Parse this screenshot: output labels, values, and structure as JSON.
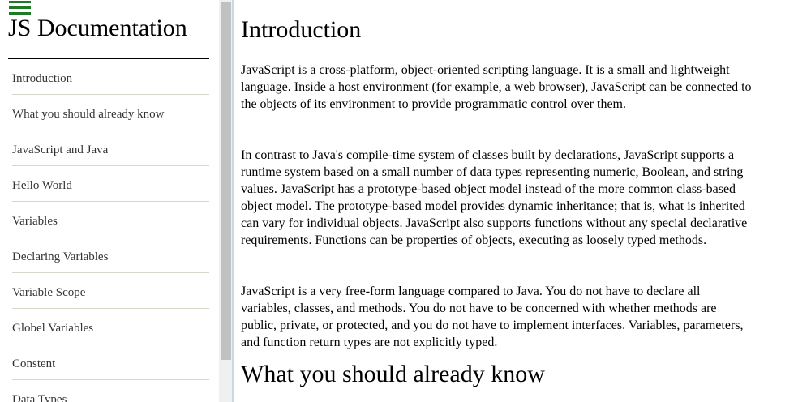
{
  "sidebar": {
    "menu_icon": "hamburger-menu-icon",
    "menu_icon_color": "#1e7a27",
    "title": "JS Documentation",
    "items": [
      {
        "label": "Introduction"
      },
      {
        "label": "What you should already know"
      },
      {
        "label": "JavaScript and Java"
      },
      {
        "label": "Hello World"
      },
      {
        "label": "Variables"
      },
      {
        "label": "Declaring Variables"
      },
      {
        "label": "Variable Scope"
      },
      {
        "label": "Globel Variables"
      },
      {
        "label": "Constent"
      },
      {
        "label": "Data Types"
      }
    ]
  },
  "main": {
    "sections": [
      {
        "heading": "Introduction",
        "paragraphs": [
          "JavaScript is a cross-platform, object-oriented scripting language. It is a small and lightweight language. Inside a host environment (for example, a web browser), JavaScript can be connected to the objects of its environment to provide programmatic control over them.",
          "In contrast to Java's compile-time system of classes built by declarations, JavaScript supports a runtime system based on a small number of data types representing numeric, Boolean, and string values. JavaScript has a prototype-based object model instead of the more common class-based object model. The prototype-based model provides dynamic inheritance; that is, what is inherited can vary for individual objects. JavaScript also supports functions without any special declarative requirements. Functions can be properties of objects, executing as loosely typed methods.",
          "JavaScript is a very free-form language compared to Java. You do not have to declare all variables, classes, and methods. You do not have to be concerned with whether methods are public, private, or protected, and you do not have to implement interfaces. Variables, parameters, and function return types are not explicitly typed."
        ]
      },
      {
        "heading": "What you should already know"
      }
    ]
  }
}
